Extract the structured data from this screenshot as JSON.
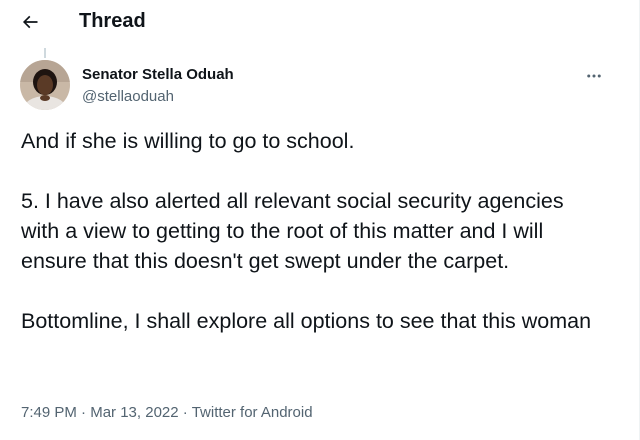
{
  "header": {
    "title": "Thread"
  },
  "author": {
    "name": "Senator Stella Oduah",
    "handle": "@stellaoduah"
  },
  "tweet": {
    "paragraphs": [
      "And if she is willing to go to school.",
      "5. I have also alerted all relevant social security agencies with a view to getting to the root of this matter and I will ensure that this doesn't get swept under the carpet.",
      "Bottomline, I shall explore all options to see that this woman"
    ]
  },
  "meta": {
    "time": "7:49 PM",
    "separator": "·",
    "date": "Mar 13, 2022",
    "source": "Twitter for Android"
  },
  "colors": {
    "text_primary": "#0f1419",
    "text_secondary": "#536471",
    "divider": "#eff3f4"
  },
  "icons": {
    "back": "arrow-left-icon",
    "more": "more-horizontal-icon"
  }
}
